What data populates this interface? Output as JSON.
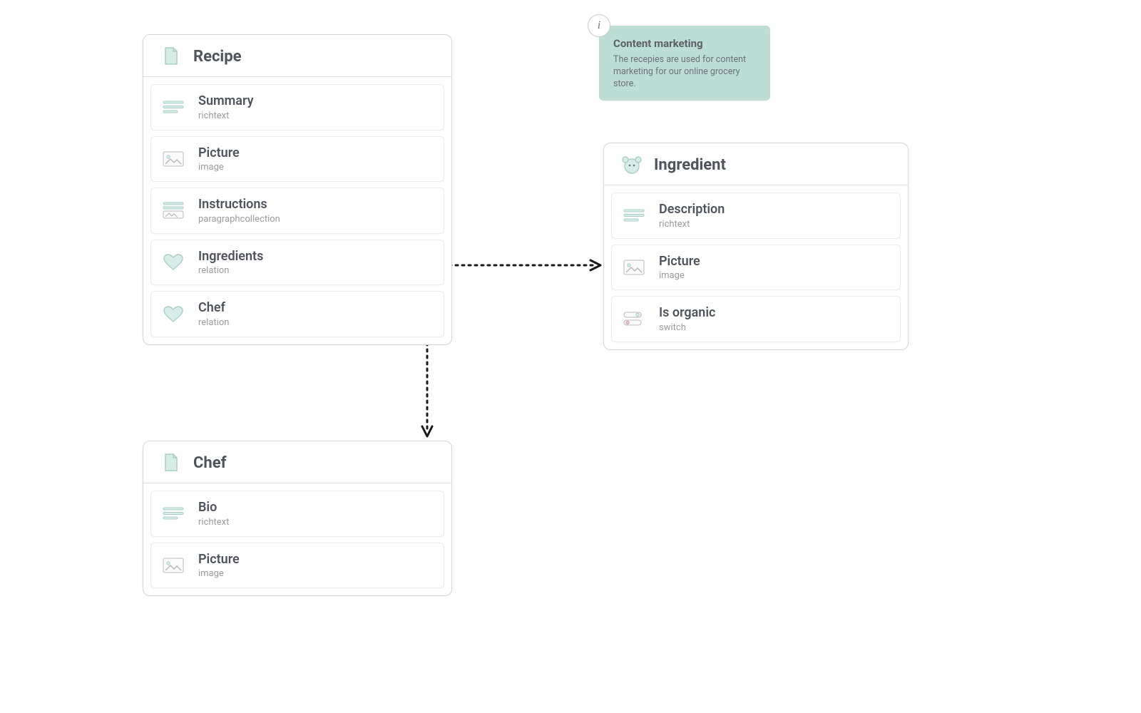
{
  "note": {
    "title": "Content marketing",
    "body": "The recepies are used for content marketing for our online grocery store."
  },
  "entities": {
    "recipe": {
      "title": "Recipe",
      "fields": [
        {
          "label": "Summary",
          "type": "richtext",
          "icon": "lines"
        },
        {
          "label": "Picture",
          "type": "image",
          "icon": "image"
        },
        {
          "label": "Instructions",
          "type": "paragraphcollection",
          "icon": "paragraphs"
        },
        {
          "label": "Ingredients",
          "type": "relation",
          "icon": "heart"
        },
        {
          "label": "Chef",
          "type": "relation",
          "icon": "heart"
        }
      ]
    },
    "ingredient": {
      "title": "Ingredient",
      "fields": [
        {
          "label": "Description",
          "type": "richtext",
          "icon": "lines"
        },
        {
          "label": "Picture",
          "type": "image",
          "icon": "image"
        },
        {
          "label": "Is organic",
          "type": "switch",
          "icon": "switch"
        }
      ]
    },
    "chef": {
      "title": "Chef",
      "fields": [
        {
          "label": "Bio",
          "type": "richtext",
          "icon": "lines"
        },
        {
          "label": "Picture",
          "type": "image",
          "icon": "image"
        }
      ]
    }
  },
  "colors": {
    "mint_fill": "#d7ede8",
    "mint_stroke": "#a9cfc6",
    "grey_stroke": "#b9b9b9",
    "text_dark": "#4f545c"
  }
}
